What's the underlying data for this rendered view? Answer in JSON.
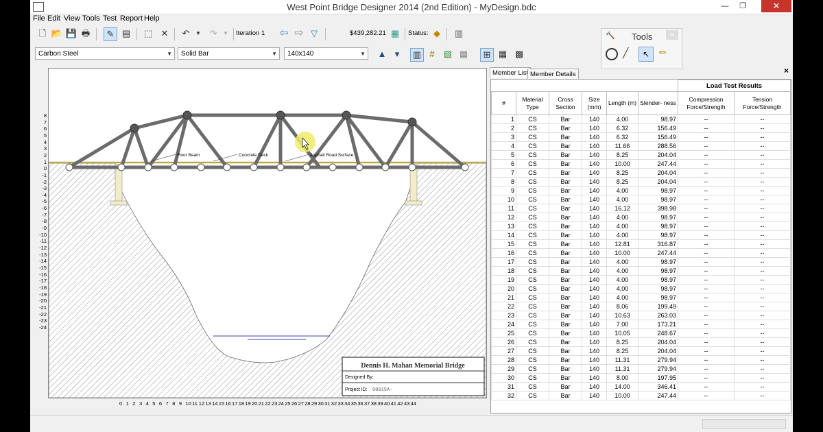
{
  "window": {
    "title": "West Point Bridge Designer 2014 (2nd Edition) - MyDesign.bdc"
  },
  "menu": [
    "File",
    "Edit",
    "View",
    "Tools",
    "Test",
    "Report",
    "Help"
  ],
  "toolbar": {
    "iteration": "Iteration 1",
    "cost": "$439,282.21",
    "status_label": "Status:"
  },
  "selectors": {
    "material": "Carbon Steel",
    "cross_section": "Solid Bar",
    "size": "140x140"
  },
  "tools_palette": {
    "title": "Tools",
    "close": "×",
    "tools": [
      "joint-tool",
      "member-tool",
      "select-tool",
      "erase-tool"
    ]
  },
  "drawing": {
    "labels": {
      "floor_beam": "Floor Beam",
      "concrete_deck": "Concrete Deck",
      "road_surface": "Asphalt Road Surface"
    },
    "y_ticks": [
      "8",
      "7",
      "6",
      "5",
      "4",
      "3",
      "2",
      "1",
      "0",
      "-1",
      "-2",
      "-3",
      "-4",
      "-5",
      "-6",
      "-7",
      "-8",
      "-9",
      "-10",
      "-11",
      "-12",
      "-13",
      "-14",
      "-15",
      "-16",
      "-17",
      "-18",
      "-19",
      "-20",
      "-21",
      "-22",
      "-23",
      "-24"
    ],
    "x_ticks": [
      "0",
      "1",
      "2",
      "3",
      "4",
      "5",
      "6",
      "7",
      "8",
      "9",
      "10",
      "11",
      "12",
      "13",
      "14",
      "15",
      "16",
      "17",
      "18",
      "19",
      "20",
      "21",
      "22",
      "23",
      "24",
      "25",
      "26",
      "27",
      "28",
      "29",
      "30",
      "31",
      "32",
      "33",
      "34",
      "35",
      "36",
      "37",
      "38",
      "39",
      "40",
      "41",
      "42",
      "43",
      "44"
    ],
    "title_block": {
      "bridge_name": "Dennis H. Mahan Memorial Bridge",
      "designed_by": "Designed By:",
      "project_id_label": "Project ID:",
      "project_id": "00015A-"
    }
  },
  "panel": {
    "tabs": [
      "Member List",
      "Member Details"
    ],
    "close": "×",
    "group_header": "Load Test Results",
    "columns": [
      "#",
      "Material Type",
      "Cross Section",
      "Size (mm)",
      "Length (m)",
      "Slender- ness",
      "Compression Force/Strength",
      "Tension Force/Strength"
    ],
    "rows": [
      [
        "1",
        "CS",
        "Bar",
        "140",
        "4.00",
        "98.97",
        "--",
        "--"
      ],
      [
        "2",
        "CS",
        "Bar",
        "140",
        "6.32",
        "156.49",
        "--",
        "--"
      ],
      [
        "3",
        "CS",
        "Bar",
        "140",
        "6.32",
        "156.49",
        "--",
        "--"
      ],
      [
        "4",
        "CS",
        "Bar",
        "140",
        "11.66",
        "288.56",
        "--",
        "--"
      ],
      [
        "5",
        "CS",
        "Bar",
        "140",
        "8.25",
        "204.04",
        "--",
        "--"
      ],
      [
        "6",
        "CS",
        "Bar",
        "140",
        "10.00",
        "247.44",
        "--",
        "--"
      ],
      [
        "7",
        "CS",
        "Bar",
        "140",
        "8.25",
        "204.04",
        "--",
        "--"
      ],
      [
        "8",
        "CS",
        "Bar",
        "140",
        "8.25",
        "204.04",
        "--",
        "--"
      ],
      [
        "9",
        "CS",
        "Bar",
        "140",
        "4.00",
        "98.97",
        "--",
        "--"
      ],
      [
        "10",
        "CS",
        "Bar",
        "140",
        "4.00",
        "98.97",
        "--",
        "--"
      ],
      [
        "11",
        "CS",
        "Bar",
        "140",
        "16.12",
        "398.98",
        "--",
        "--"
      ],
      [
        "12",
        "CS",
        "Bar",
        "140",
        "4.00",
        "98.97",
        "--",
        "--"
      ],
      [
        "13",
        "CS",
        "Bar",
        "140",
        "4.00",
        "98.97",
        "--",
        "--"
      ],
      [
        "14",
        "CS",
        "Bar",
        "140",
        "4.00",
        "98.97",
        "--",
        "--"
      ],
      [
        "15",
        "CS",
        "Bar",
        "140",
        "12.81",
        "316.87",
        "--",
        "--"
      ],
      [
        "16",
        "CS",
        "Bar",
        "140",
        "10.00",
        "247.44",
        "--",
        "--"
      ],
      [
        "17",
        "CS",
        "Bar",
        "140",
        "4.00",
        "98.97",
        "--",
        "--"
      ],
      [
        "18",
        "CS",
        "Bar",
        "140",
        "4.00",
        "98.97",
        "--",
        "--"
      ],
      [
        "19",
        "CS",
        "Bar",
        "140",
        "4.00",
        "98.97",
        "--",
        "--"
      ],
      [
        "20",
        "CS",
        "Bar",
        "140",
        "4.00",
        "98.97",
        "--",
        "--"
      ],
      [
        "21",
        "CS",
        "Bar",
        "140",
        "4.00",
        "98.97",
        "--",
        "--"
      ],
      [
        "22",
        "CS",
        "Bar",
        "140",
        "8.06",
        "199.49",
        "--",
        "--"
      ],
      [
        "23",
        "CS",
        "Bar",
        "140",
        "10.63",
        "263.03",
        "--",
        "--"
      ],
      [
        "24",
        "CS",
        "Bar",
        "140",
        "7.00",
        "173.21",
        "--",
        "--"
      ],
      [
        "25",
        "CS",
        "Bar",
        "140",
        "10.05",
        "248.67",
        "--",
        "--"
      ],
      [
        "26",
        "CS",
        "Bar",
        "140",
        "8.25",
        "204.04",
        "--",
        "--"
      ],
      [
        "27",
        "CS",
        "Bar",
        "140",
        "8.25",
        "204.04",
        "--",
        "--"
      ],
      [
        "28",
        "CS",
        "Bar",
        "140",
        "11.31",
        "279.94",
        "--",
        "--"
      ],
      [
        "29",
        "CS",
        "Bar",
        "140",
        "11.31",
        "279.94",
        "--",
        "--"
      ],
      [
        "30",
        "CS",
        "Bar",
        "140",
        "8.00",
        "197.95",
        "--",
        "--"
      ],
      [
        "31",
        "CS",
        "Bar",
        "140",
        "14.00",
        "346.41",
        "--",
        "--"
      ],
      [
        "32",
        "CS",
        "Bar",
        "140",
        "10.00",
        "247.44",
        "--",
        "--"
      ]
    ]
  }
}
